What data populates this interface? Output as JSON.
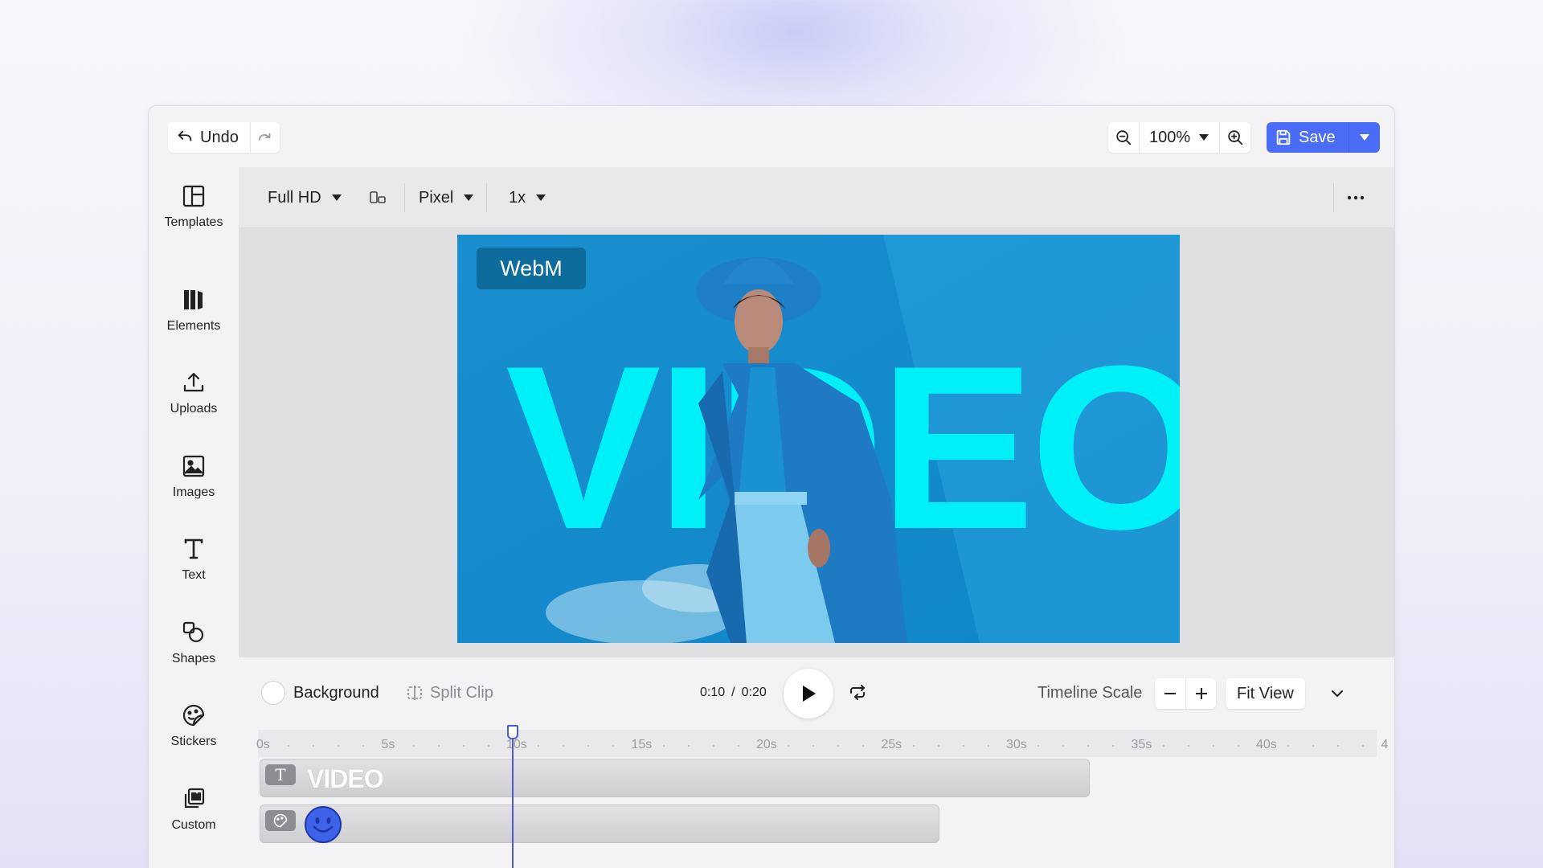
{
  "topbar": {
    "undo_label": "Undo",
    "zoom_value": "100%",
    "save_label": "Save"
  },
  "sidebar": {
    "items": [
      {
        "label": "Templates",
        "icon": "templates-icon"
      },
      {
        "label": "Elements",
        "icon": "elements-icon"
      },
      {
        "label": "Uploads",
        "icon": "upload-icon"
      },
      {
        "label": "Images",
        "icon": "image-icon"
      },
      {
        "label": "Text",
        "icon": "text-icon"
      },
      {
        "label": "Shapes",
        "icon": "shapes-icon"
      },
      {
        "label": "Stickers",
        "icon": "sticker-icon"
      },
      {
        "label": "Custom",
        "icon": "custom-icon"
      }
    ]
  },
  "toolbar": {
    "resolution": "Full HD",
    "unit": "Pixel",
    "scale": "1x"
  },
  "canvas": {
    "badge": "WebM",
    "headline": "VIDEO",
    "colors": {
      "background": "#1793d4",
      "headline": "#00f0f8",
      "badge": "#0d6c9c"
    }
  },
  "timeline": {
    "background_label": "Background",
    "split_clip_label": "Split Clip",
    "current_time": "0:10",
    "separator": "/",
    "total_time": "0:20",
    "scale_label": "Timeline Scale",
    "fit_view_label": "Fit View",
    "ruler_labels": [
      "0s",
      "5s",
      "10s",
      "15s",
      "20s",
      "25s",
      "30s",
      "35s",
      "40s",
      "4"
    ],
    "playhead_seconds": 10,
    "tracks": [
      {
        "type": "text",
        "label": "VIDEO",
        "start_s": 0,
        "end_s": 33.2
      },
      {
        "type": "sticker",
        "label": "",
        "start_s": 0,
        "end_s": 27.2
      }
    ]
  },
  "theme": {
    "accent": "#4a6cf7",
    "playhead": "#4a5bd4"
  }
}
